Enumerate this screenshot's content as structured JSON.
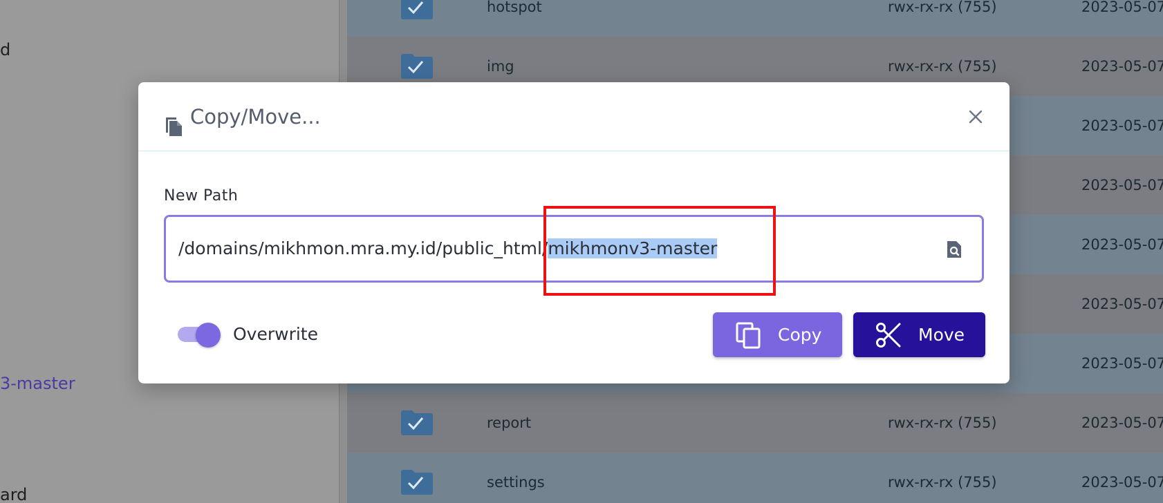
{
  "sidebar": {
    "items": [
      {
        "label": "d"
      },
      {
        "label": "3-master"
      },
      {
        "label": "ard"
      }
    ]
  },
  "files": [
    {
      "name": "hotspot",
      "permissions": "rwx-rx-rx (755)",
      "date": "2023-05-07"
    },
    {
      "name": "img",
      "permissions": "rwx-rx-rx (755)",
      "date": "2023-05-07"
    },
    {
      "name": "",
      "permissions": "",
      "date": "2023-05-07"
    },
    {
      "name": "",
      "permissions": "",
      "date": "2023-05-07"
    },
    {
      "name": "",
      "permissions": "",
      "date": "2023-05-07"
    },
    {
      "name": "",
      "permissions": "",
      "date": "2023-05-07"
    },
    {
      "name": "",
      "permissions": "",
      "date": "2023-05-07"
    },
    {
      "name": "report",
      "permissions": "rwx-rx-rx (755)",
      "date": "2023-05-07"
    },
    {
      "name": "settings",
      "permissions": "rwx-rx-rx (755)",
      "date": "2023-05-07"
    }
  ],
  "modal": {
    "title": "Copy/Move...",
    "field_label": "New Path",
    "path_prefix": "/domains/mikhmon.mra.my.id/public_html/",
    "path_selected": "mikhmonv3-master",
    "overwrite_label": "Overwrite",
    "overwrite_on": true,
    "copy_label": "Copy",
    "move_label": "Move"
  },
  "colors": {
    "accent": "#7b66df",
    "move_button": "#26119a",
    "input_border": "#8b7ae2",
    "selection": "#a9cbf5",
    "annotation": "#ee1111"
  },
  "icons": {
    "title": "file-copy-icon",
    "close": "close-icon",
    "browse": "file-search-icon",
    "copy": "copy-icon",
    "move": "scissors-icon",
    "folder": "folder-check-icon"
  }
}
